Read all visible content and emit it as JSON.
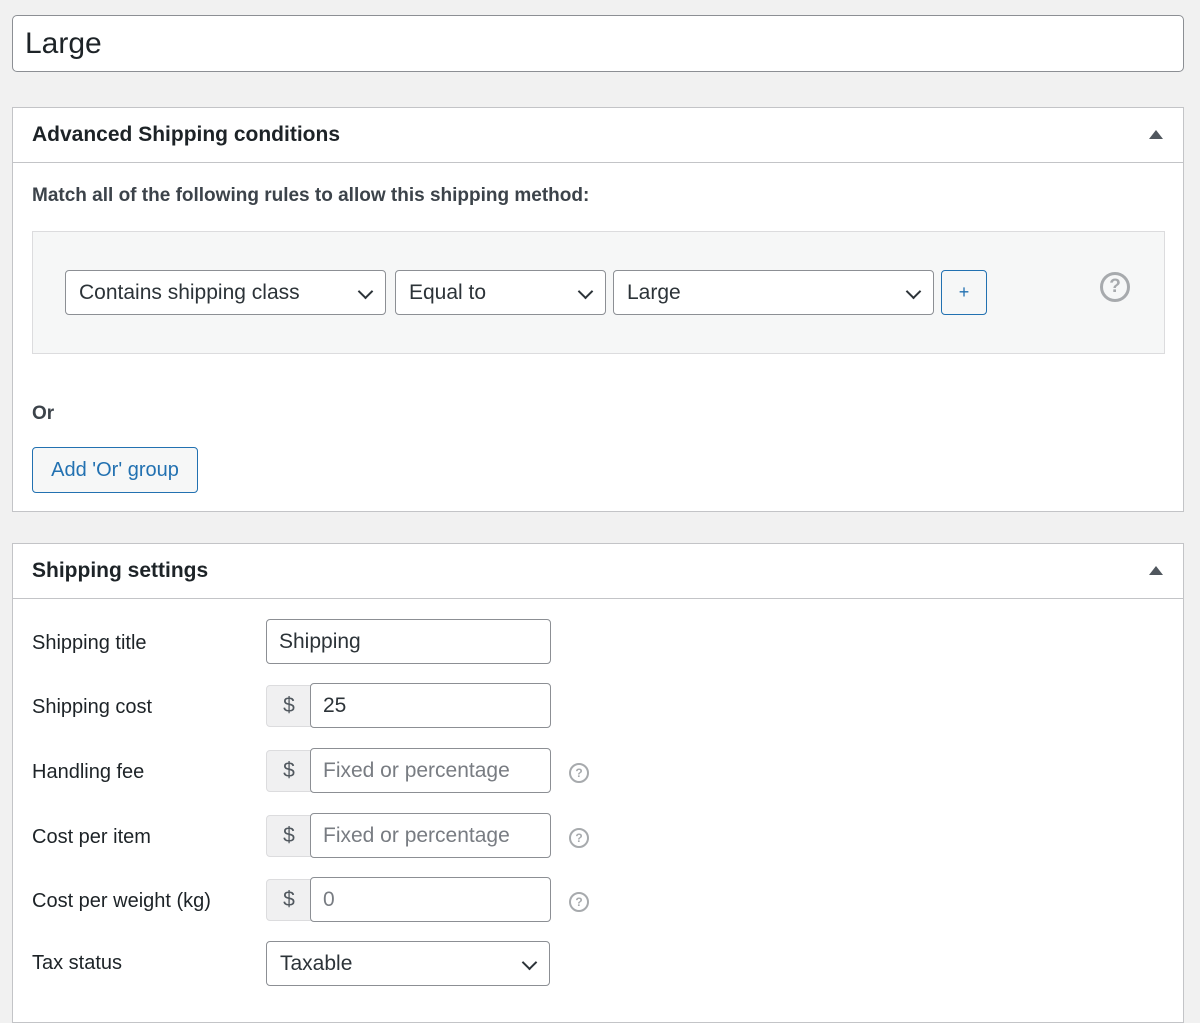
{
  "title_value": "Large",
  "conditions": {
    "header": "Advanced Shipping conditions",
    "match_text": "Match all of the following rules to allow this shipping method:",
    "rule": {
      "condition": "Contains shipping class",
      "operator": "Equal to",
      "value": "Large",
      "add_label": "+",
      "help_glyph": "?"
    },
    "or_label": "Or",
    "add_or_group": "Add 'Or' group"
  },
  "settings": {
    "header": "Shipping settings",
    "help_glyph": "?",
    "currency": "$",
    "rows": {
      "shipping_title": {
        "label": "Shipping title",
        "value": "Shipping"
      },
      "shipping_cost": {
        "label": "Shipping cost",
        "value": "25"
      },
      "handling_fee": {
        "label": "Handling fee",
        "placeholder": "Fixed or percentage"
      },
      "cost_per_item": {
        "label": "Cost per item",
        "placeholder": "Fixed or percentage"
      },
      "cost_per_weight": {
        "label": "Cost per weight (kg)",
        "placeholder": "0"
      },
      "tax_status": {
        "label": "Tax status",
        "value": "Taxable"
      }
    }
  },
  "icons": {
    "toggle": "triangle-up-icon",
    "dropdown": "chevron-down-icon",
    "help": "question-circle-icon"
  },
  "colors": {
    "accent": "#2271b1",
    "background": "#f1f1f1",
    "border": "#c3c4c7",
    "rule_group_bg": "#f6f7f7"
  }
}
